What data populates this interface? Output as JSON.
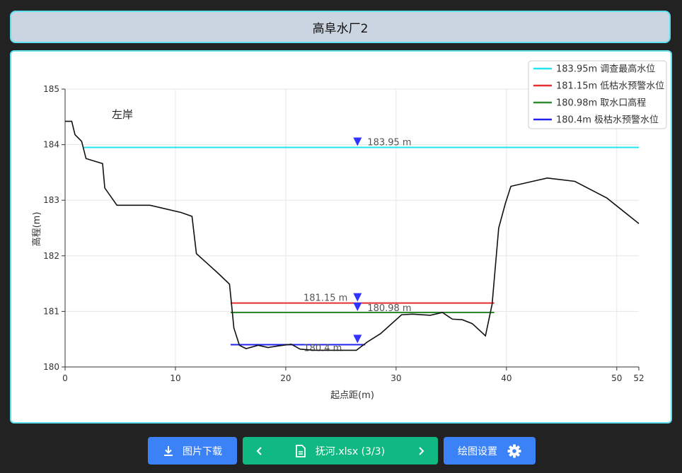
{
  "header": {
    "title": "高阜水厂2"
  },
  "chart_data": {
    "type": "line",
    "annotation": "左岸",
    "xlabel": "起点距(m)",
    "ylabel": "高程(m)",
    "xlim": [
      0,
      52
    ],
    "ylim": [
      180,
      185
    ],
    "xticks": [
      "0",
      "10",
      "20",
      "30",
      "40",
      "50",
      "52"
    ],
    "xtick_values": [
      0,
      10,
      20,
      30,
      40,
      50,
      52
    ],
    "yticks": [
      "180",
      "181",
      "182",
      "183",
      "184",
      "185"
    ],
    "ytick_values": [
      180,
      181,
      182,
      183,
      184,
      185
    ],
    "grid": true,
    "legend_position": "top-right",
    "profile": {
      "color": "#111111",
      "x": [
        0,
        0.6,
        0.9,
        1.5,
        1.9,
        3.4,
        3.6,
        4.7,
        7.7,
        10.5,
        11.5,
        11.9,
        12.9,
        13.9,
        14.9,
        15.1,
        15.3,
        15.8,
        16.4,
        17.5,
        18.4,
        19.4,
        20.5,
        21.3,
        22.6,
        25.1,
        26.4,
        27.4,
        28.6,
        30.5,
        31.5,
        33.1,
        34.2,
        35.1,
        36.0,
        36.9,
        38.1,
        38.7,
        39.3,
        39.9,
        40.4,
        43.7,
        46.2,
        49.1,
        52
      ],
      "y": [
        184.42,
        184.42,
        184.18,
        184.06,
        183.75,
        183.66,
        183.22,
        182.91,
        182.91,
        182.78,
        182.71,
        182.04,
        181.86,
        181.68,
        181.49,
        181.1,
        180.7,
        180.39,
        180.33,
        180.39,
        180.35,
        180.38,
        180.41,
        180.32,
        180.3,
        180.3,
        180.3,
        180.45,
        180.6,
        180.94,
        180.95,
        180.93,
        180.98,
        180.86,
        180.85,
        180.78,
        180.56,
        181.13,
        182.5,
        182.94,
        183.25,
        183.4,
        183.34,
        183.04,
        182.58
      ]
    },
    "levels": [
      {
        "value": 183.95,
        "label": "183.95 m",
        "legend": "183.95m 调查最高水位",
        "color": "#22e5f0",
        "x_start": 1.6,
        "x_end": 52
      },
      {
        "value": 181.15,
        "label": "181.15 m",
        "legend": "181.15m 低枯水预警水位",
        "color": "#e62f2f",
        "x_start": 15.0,
        "x_end": 38.9
      },
      {
        "value": 180.98,
        "label": "180.98 m",
        "legend": "180.98m 取水口高程",
        "color": "#2e8b2e",
        "x_start": 15.0,
        "x_end": 38.9
      },
      {
        "value": 180.4,
        "label": "180.4 m",
        "legend": "180.4m 极枯水预警水位",
        "color": "#2222ee",
        "x_start": 15.0,
        "x_end": 27.2
      }
    ],
    "marker_x": 26.5,
    "marker_color": "#3333ff"
  },
  "toolbar": {
    "download_label": "图片下载",
    "file_label": "抚河.xlsx (3/3)",
    "settings_label": "绘图设置",
    "primary_color": "#3b82f6",
    "file_color": "#10b981"
  }
}
